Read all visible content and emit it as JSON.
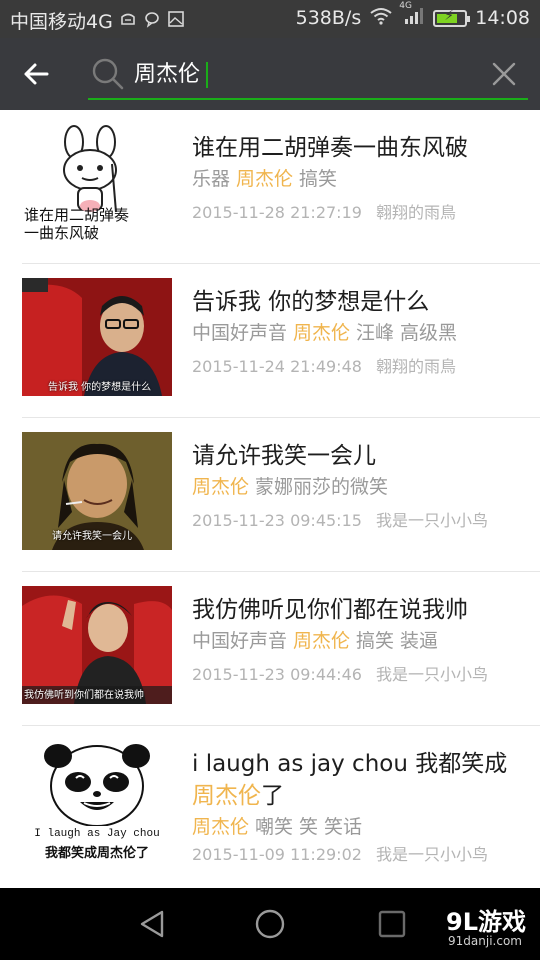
{
  "status_bar": {
    "carrier": "中国移动4G",
    "speed": "538B/s",
    "network": "4G",
    "time": "14:08"
  },
  "search": {
    "query": "周杰伦"
  },
  "results": [
    {
      "title": "谁在用二胡弹奏一曲东风破",
      "tags": [
        "乐器",
        "周杰伦",
        "搞笑"
      ],
      "date": "2015-11-28 21:27:19",
      "author": "翱翔的雨鳥",
      "thumb_caption": "谁在用二胡弹奏一曲东风破"
    },
    {
      "title": "告诉我 你的梦想是什么",
      "tags": [
        "中国好声音",
        "周杰伦",
        "汪峰",
        "高级黑"
      ],
      "date": "2015-11-24 21:49:48",
      "author": "翱翔的雨鳥",
      "thumb_caption": "告诉我 你的梦想是什么"
    },
    {
      "title": "请允许我笑一会儿",
      "tags": [
        "周杰伦",
        "蒙娜丽莎的微笑"
      ],
      "date": "2015-11-23 09:45:15",
      "author": "我是一只小小鸟",
      "thumb_caption": "请允许我笑一会儿"
    },
    {
      "title": "我仿佛听见你们都在说我帅",
      "tags": [
        "中国好声音",
        "周杰伦",
        "搞笑",
        "装逼"
      ],
      "date": "2015-11-23 09:44:46",
      "author": "我是一只小小鸟",
      "thumb_caption": "我仿佛听到你们都在说我帅"
    },
    {
      "title_line1": "i laugh as jay chou 我都笑成",
      "title_hl": "周杰伦",
      "title_tail": "了",
      "tags": [
        "周杰伦",
        "嘲笑",
        "笑",
        "笑话"
      ],
      "date": "2015-11-09 11:29:02",
      "author": "我是一只小小鸟",
      "thumb_caption_en": "I laugh as Jay chou",
      "thumb_caption": "我都笑成周杰伦了"
    }
  ],
  "highlight_tag": "周杰伦",
  "colors": {
    "accent": "#1aad19",
    "highlight": "#f0b54e",
    "header_bg": "#393a3e"
  },
  "watermark": {
    "logo": "9L游戏",
    "site": "91danji.com"
  }
}
